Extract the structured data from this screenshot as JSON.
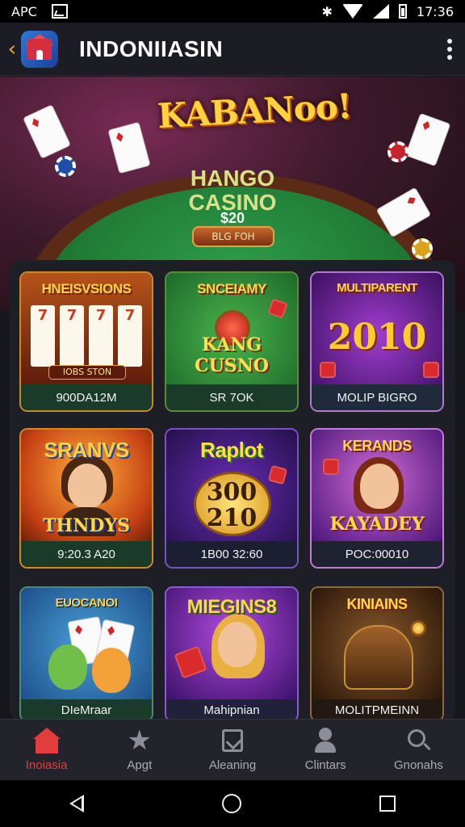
{
  "status_bar": {
    "left_text": "APC",
    "time": "17:36"
  },
  "app_bar": {
    "title": "INDONIIASIN"
  },
  "hero": {
    "logo": "KABANoo!",
    "line1": "HANGO",
    "line2": "CASINO",
    "amount": "$20",
    "button": "BLG FOH"
  },
  "games": [
    {
      "title": "HNEISVSIONS",
      "big": "",
      "caption": "900DA12M"
    },
    {
      "title": "SNCEIAMY",
      "big": "KANG CUSNO",
      "caption": "SR 7OK"
    },
    {
      "title": "MULTIPARENT",
      "big": "2010",
      "caption": "MOLIP BIGRO"
    },
    {
      "title": "SRANVS",
      "big": "THNDYS",
      "caption": "9:20.3 A20"
    },
    {
      "title": "Raplot",
      "big": "300 210",
      "caption": "1B00 32:60"
    },
    {
      "title": "KERANDS",
      "big": "KAYADEY",
      "caption": "POC:00010"
    },
    {
      "title": "EUOCANOI",
      "big": "",
      "caption": "DIeMraar"
    },
    {
      "title": "MIEGINS8",
      "big": "",
      "caption": "Mahipnian"
    },
    {
      "title": "KINIAINS",
      "big": "",
      "caption": "MOLITPMEINN"
    }
  ],
  "slot_reels": [
    "7",
    "7",
    "7",
    "7"
  ],
  "slot_button": "IOBS STON",
  "bottom_nav": [
    {
      "label": "Inoiasia",
      "icon": "home-icon",
      "active": true
    },
    {
      "label": "Apgt",
      "icon": "star-icon",
      "active": false
    },
    {
      "label": "Aleaning",
      "icon": "calendar-check-icon",
      "active": false
    },
    {
      "label": "Clintars",
      "icon": "user-icon",
      "active": false
    },
    {
      "label": "Gnonahs",
      "icon": "search-icon",
      "active": false
    }
  ],
  "colors": {
    "accent": "#e23d3d",
    "nav_inactive": "#a9abb4",
    "felt": "#1f7a35",
    "gold": "#ffd23f"
  }
}
